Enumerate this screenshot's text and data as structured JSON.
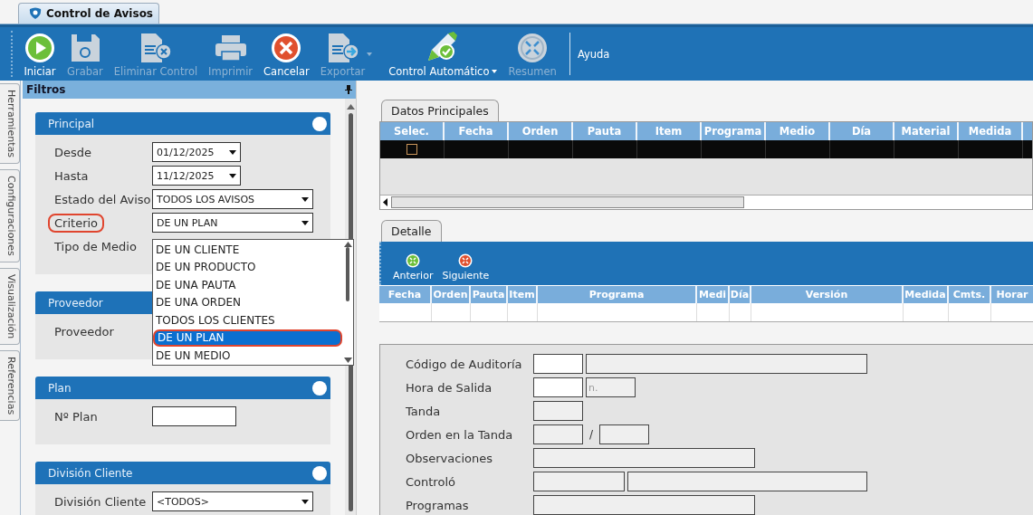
{
  "app_tab": {
    "title": "Control de Avisos",
    "selected": true
  },
  "toolbar": {
    "buttons": [
      {
        "label": "Iniciar",
        "disabled": false,
        "has_menu": false
      },
      {
        "label": "Grabar",
        "disabled": true,
        "has_menu": false
      },
      {
        "label": "Eliminar Control",
        "disabled": true,
        "has_menu": false
      },
      {
        "label": "Imprimir",
        "disabled": true,
        "has_menu": false
      },
      {
        "label": "Cancelar",
        "disabled": false,
        "has_menu": false
      },
      {
        "label": "Exportar",
        "disabled": true,
        "has_menu": true
      },
      {
        "label": "Control Automático",
        "disabled": false,
        "has_menu": true
      },
      {
        "label": "Resumen",
        "disabled": true,
        "has_menu": false
      }
    ],
    "help": "Ayuda"
  },
  "side_tabs": [
    {
      "label": "Herramientas"
    },
    {
      "label": "Configuraciones"
    },
    {
      "label": "Visualización"
    },
    {
      "label": "Referencias"
    }
  ],
  "filters": {
    "title": "Filtros",
    "sections": [
      {
        "title": "Principal",
        "has_toggle": true,
        "fields": [
          {
            "label": "Desde",
            "kind": "date",
            "value": "01/12/2025",
            "highlighted": false
          },
          {
            "label": "Hasta",
            "kind": "date",
            "value": "11/12/2025",
            "highlighted": false
          },
          {
            "label": "Estado del Aviso",
            "kind": "combo",
            "value": "TODOS LOS AVISOS",
            "highlighted": false
          },
          {
            "label": "Criterio",
            "kind": "combo",
            "value": "DE UN PLAN",
            "highlighted": true
          },
          {
            "label": "Tipo de Medio",
            "kind": "covered",
            "highlighted": false
          }
        ]
      },
      {
        "title": "Proveedor",
        "has_toggle": false,
        "fields": [
          {
            "label": "Proveedor",
            "kind": "covered",
            "highlighted": false
          }
        ]
      },
      {
        "title": "Plan",
        "has_toggle": true,
        "fields": [
          {
            "label": "Nº Plan",
            "kind": "text",
            "highlighted": false
          }
        ]
      },
      {
        "title": "División Cliente",
        "has_toggle": true,
        "fields": [
          {
            "label": "División Cliente",
            "kind": "combo",
            "value": "<TODOS>",
            "highlighted": false
          }
        ]
      }
    ],
    "dropdown": {
      "options": [
        {
          "label": "DE UN CLIENTE",
          "selected": false,
          "highlighted": false
        },
        {
          "label": "DE UN PRODUCTO",
          "selected": false,
          "highlighted": false
        },
        {
          "label": "DE UNA PAUTA",
          "selected": false,
          "highlighted": false
        },
        {
          "label": "DE UNA ORDEN",
          "selected": false,
          "highlighted": false
        },
        {
          "label": "TODOS LOS CLIENTES",
          "selected": false,
          "highlighted": false
        },
        {
          "label": "DE UN PLAN",
          "selected": true,
          "highlighted": true
        },
        {
          "label": "DE UN MEDIO",
          "selected": false,
          "highlighted": false
        }
      ]
    }
  },
  "main_grid": {
    "tab": "Datos Principales",
    "columns": [
      "Selec.",
      "Fecha",
      "Orden",
      "Pauta",
      "Item",
      "Programa",
      "Medio",
      "Día",
      "Material",
      "Medida"
    ],
    "rows": [
      {
        "checked": false,
        "selected": true
      }
    ]
  },
  "detail": {
    "tab": "Detalle",
    "buttons": [
      {
        "label": "Anterior"
      },
      {
        "label": "Siguiente"
      }
    ],
    "columns": [
      "Fecha",
      "Orden",
      "Pauta",
      "Item",
      "Programa",
      "Medi",
      "Día",
      "Versión",
      "Medida",
      "Cmts.",
      "Horar"
    ],
    "form": [
      {
        "label": "Código de Auditoría",
        "fields": [
          {
            "kind": "field",
            "enabled": true
          },
          {
            "kind": "field",
            "enabled": false
          }
        ]
      },
      {
        "label": "Hora de Salida",
        "fields": [
          {
            "kind": "field",
            "enabled": true
          },
          {
            "kind": "field",
            "enabled": false,
            "placeholder": "n."
          }
        ]
      },
      {
        "label": "Tanda",
        "fields": [
          {
            "kind": "field",
            "enabled": false
          }
        ]
      },
      {
        "label": "Orden en la Tanda",
        "fields": [
          {
            "kind": "field",
            "enabled": false
          },
          {
            "kind": "separator",
            "text": "/"
          },
          {
            "kind": "field",
            "enabled": false
          }
        ]
      },
      {
        "label": "Observaciones",
        "fields": [
          {
            "kind": "field",
            "enabled": false
          }
        ]
      },
      {
        "label": "Controló",
        "fields": [
          {
            "kind": "field",
            "enabled": false
          },
          {
            "kind": "field",
            "enabled": false
          }
        ]
      },
      {
        "label": "Programas",
        "fields": [
          {
            "kind": "field",
            "enabled": false
          }
        ]
      }
    ]
  }
}
